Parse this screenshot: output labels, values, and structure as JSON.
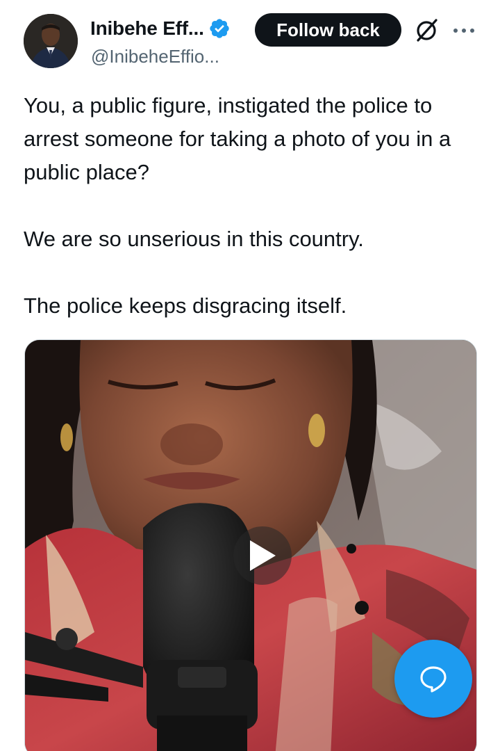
{
  "author": {
    "name": "Inibehe Eff...",
    "handle": "@InibeheEffio...",
    "verified": true
  },
  "actions": {
    "follow_label": "Follow back",
    "grok_icon": "grok-icon",
    "more_icon": "more-dots-icon"
  },
  "tweet": {
    "paragraphs": [
      "You, a public figure, instigated the police to arrest someone for taking a photo of you in a public place?",
      "We are so unserious in this country.",
      "The police keeps disgracing itself."
    ]
  },
  "media": {
    "type": "video",
    "play_icon": "play-icon"
  },
  "fab": {
    "icon": "reply-bubble-icon"
  },
  "colors": {
    "accent": "#1d9bf0",
    "text": "#0f1419",
    "secondary_text": "#536471",
    "button_bg": "#0f1419"
  }
}
